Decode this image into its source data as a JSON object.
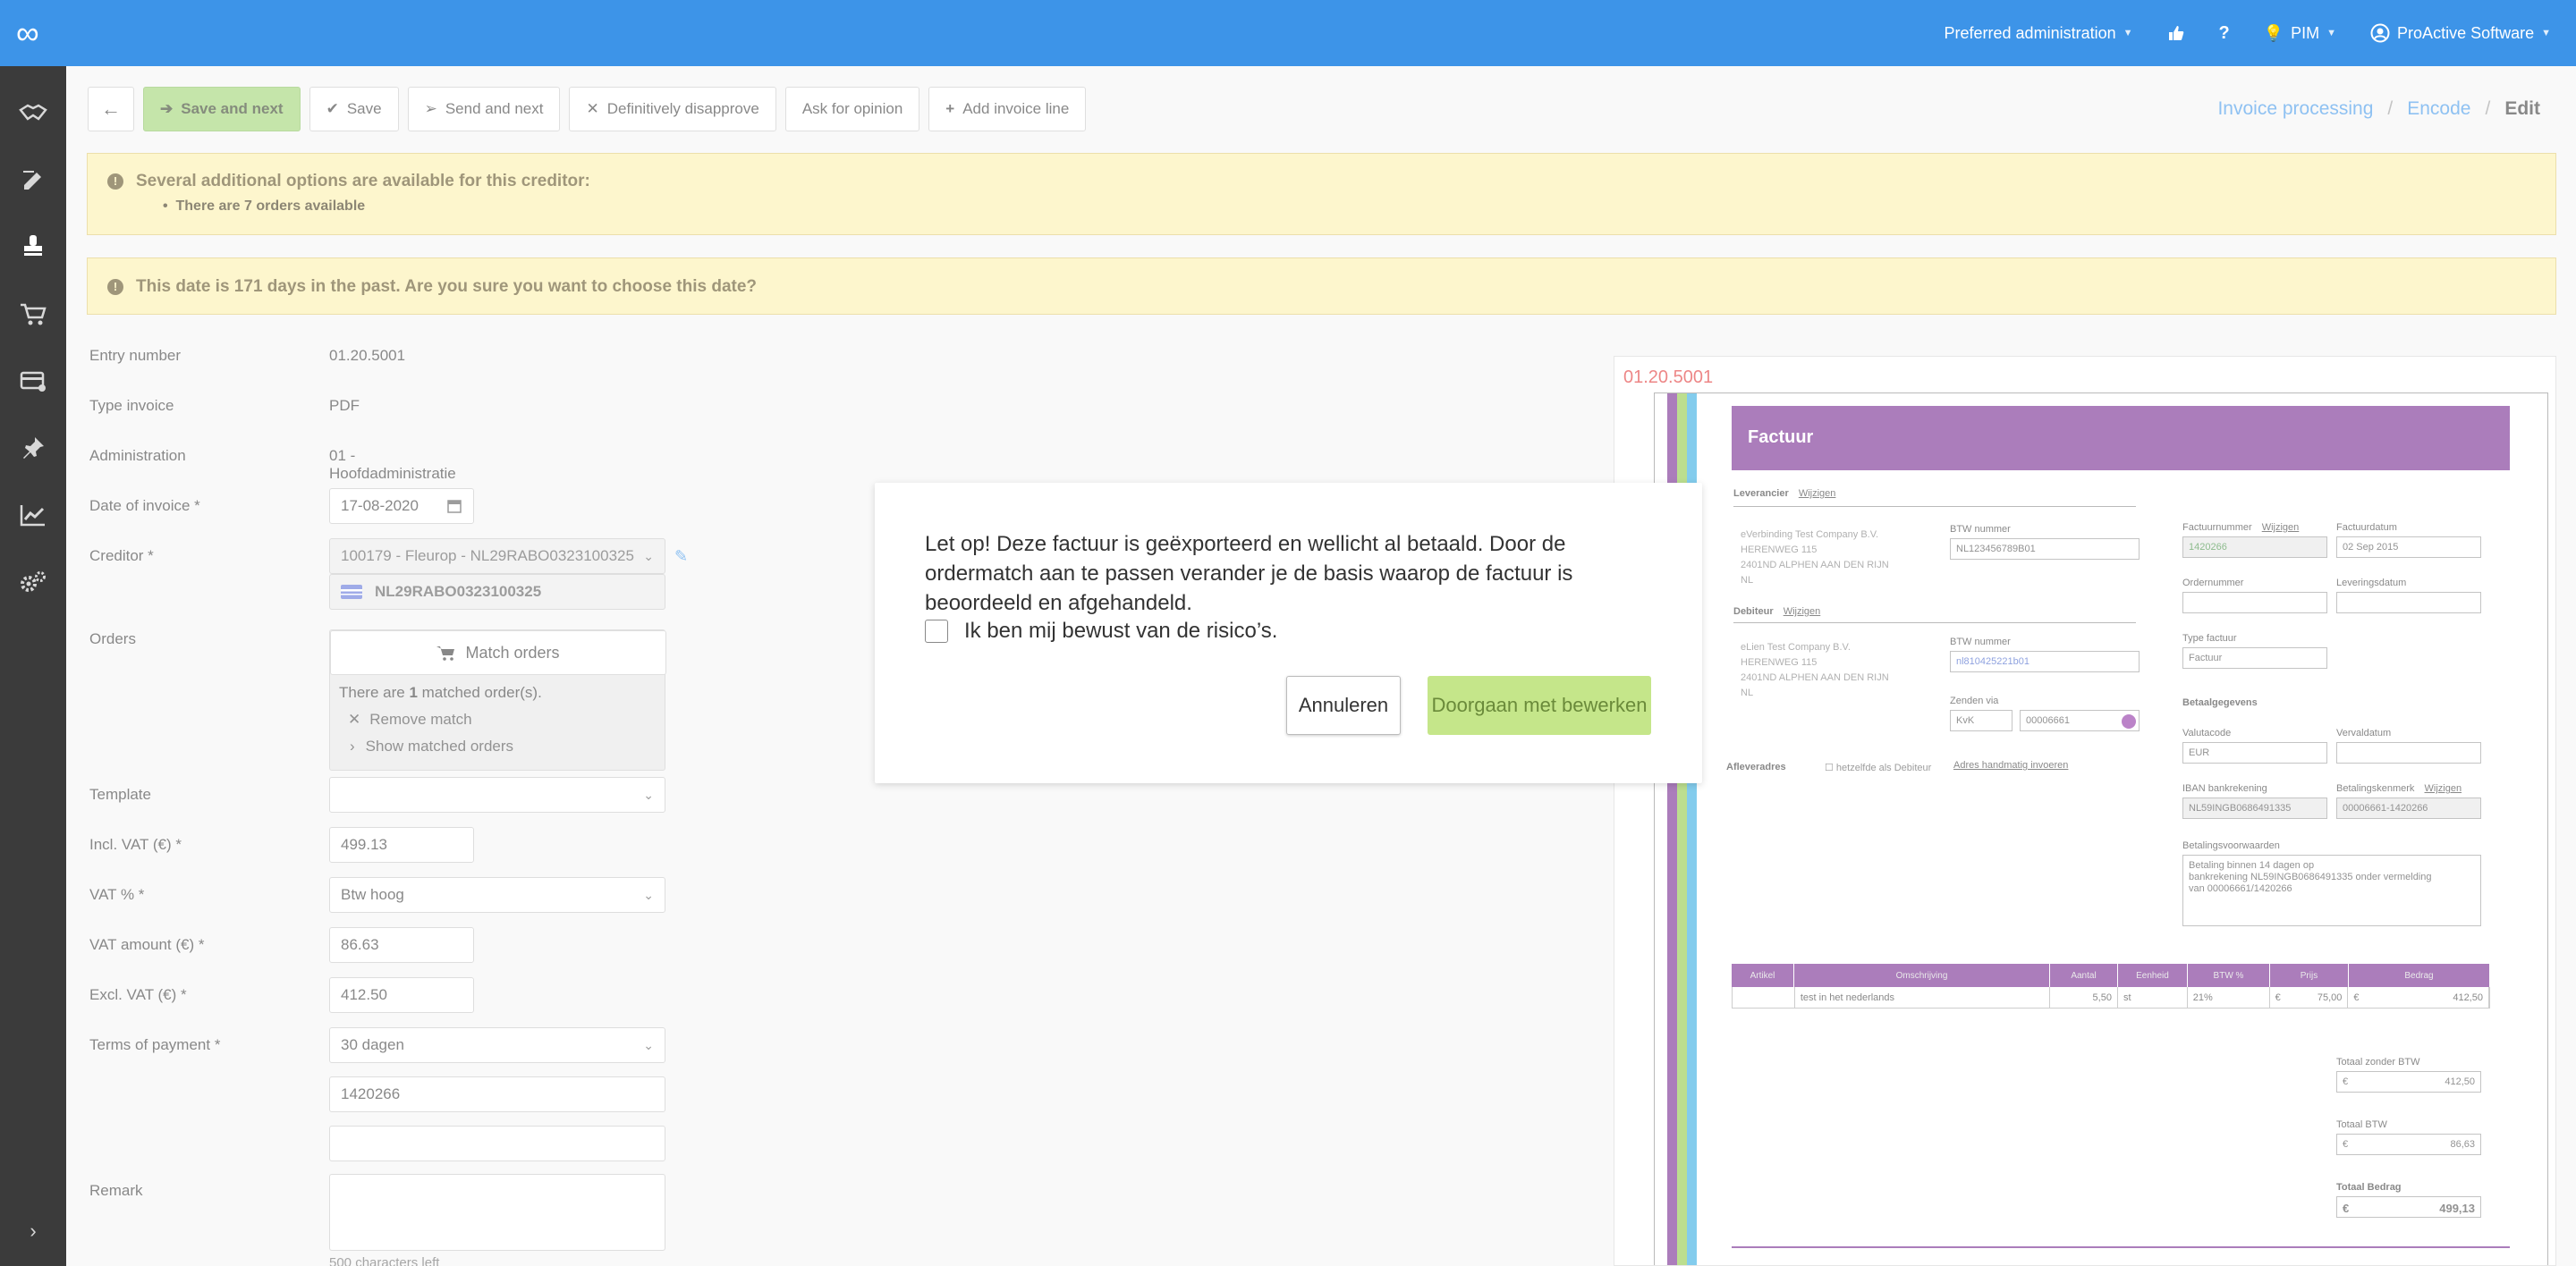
{
  "topbar": {
    "logo": "∞",
    "preferred_admin": "Preferred administration",
    "pim": "PIM",
    "user": "ProActive Software",
    "help": "?"
  },
  "toolbar": {
    "save_next": "Save and next",
    "save": "Save",
    "send_next": "Send and next",
    "disapprove": "Definitively disapprove",
    "ask_opinion": "Ask for opinion",
    "add_line": "Add invoice line"
  },
  "breadcrumb": {
    "l1": "Invoice processing",
    "l2": "Encode",
    "cur": "Edit",
    "sep": "/"
  },
  "alert1": {
    "title": "Several additional options are available for this creditor:",
    "item": "There are 7 orders available"
  },
  "alert2": {
    "text": "This date is 171 days in the past. Are you sure you want to choose this date?"
  },
  "form": {
    "entry_label": "Entry number",
    "entry_value": "01.20.5001",
    "type_label": "Type invoice",
    "type_value": "PDF",
    "admin_label": "Administration",
    "admin_value": "01 - Hoofdadministratie",
    "date_label": "Date of invoice *",
    "date_value": "17-08-2020",
    "creditor_label": "Creditor *",
    "creditor_value": "100179 - Fleurop - NL29RABO0323100325",
    "creditor_iban": "NL29RABO0323100325",
    "orders_label": "Orders",
    "match_orders": "Match orders",
    "matched_pre": "There are ",
    "matched_count": "1",
    "matched_post": " matched order(s).",
    "remove_match": "Remove match",
    "show_matched": "Show matched orders",
    "template_label": "Template",
    "template_value": "",
    "incl_label": "Incl. VAT (€) *",
    "incl_value": "499.13",
    "vatp_label": "VAT % *",
    "vatp_value": "Btw hoog",
    "vata_label": "VAT amount (€) *",
    "vata_value": "86.63",
    "excl_label": "Excl. VAT (€) *",
    "excl_value": "412.50",
    "terms_label": "Terms of payment *",
    "terms_value": "30 dagen",
    "ref_value": "1420266",
    "extra_value": "",
    "remark_label": "Remark",
    "chars_left": "500 characters left"
  },
  "modal": {
    "text": "Let op! Deze factuur is geëxporteerd en wellicht al betaald. Door de ordermatch aan te passen verander je de basis waarop de factuur is beoordeeld en afgehandeld.",
    "checkbox": "Ik ben mij bewust van de risico’s.",
    "cancel": "Annuleren",
    "continue": "Doorgaan met bewerken"
  },
  "preview": {
    "number": "01.20.5001",
    "title": "Factuur",
    "leverancier": "Leverancier",
    "wijzigen": "Wijzigen",
    "sup_name": "eVerbinding Test Company B.V.",
    "sup_street": "HERENWEG 115",
    "sup_city": "2401ND ALPHEN AAN DEN RIJN",
    "sup_country": "NL",
    "btw_label": "BTW nummer",
    "btw1": "NL123456789B01",
    "debiteur": "Debiteur",
    "deb_name": "eLien Test Company B.V.",
    "deb_street": "HERENWEG 115",
    "deb_city": "2401ND ALPHEN AAN DEN RIJN",
    "deb_country": "NL",
    "btw2": "nl810425221b01",
    "zenden_via": "Zenden via",
    "kvk": "KvK",
    "kvk_nr": "00006661",
    "afleveradres": "Afleveradres",
    "zelfde": "hetzelfde als Debiteur",
    "handmatig": "Adres handmatig invoeren",
    "factuurnummer": "Factuurnummer",
    "factuurnummer_value": "1420266",
    "factuurdatum": "Factuurdatum",
    "factuurdatum_value": "02 Sep 2015",
    "ordernummer": "Ordernummer",
    "leveringsdatum": "Leveringsdatum",
    "type_factuur": "Type factuur",
    "type_factuur_value": "Factuur",
    "betaalgegevens": "Betaalgegevens",
    "valutacode": "Valutacode",
    "valutacode_value": "EUR",
    "vervaldatum": "Vervaldatum",
    "iban_label": "IBAN bankrekening",
    "iban_value": "NL59INGB0686491335",
    "kenmerk_label": "Betalingskenmerk",
    "kenmerk_value": "00006661-1420266",
    "voorwaarden_label": "Betalingsvoorwaarden",
    "voorwaarden_l1": "Betaling binnen 14 dagen op",
    "voorwaarden_l2": "bankrekening NL59INGB0686491335 onder vermelding",
    "voorwaarden_l3": "van 00006661/1420266",
    "table_headers": [
      "Artikel",
      "Omschrijving",
      "Aantal",
      "Eenheid",
      "BTW %",
      "Prijs",
      "Bedrag"
    ],
    "table_row": [
      "",
      "test in het nederlands",
      "5,50",
      "st",
      "21%",
      "75,00",
      "412,50"
    ],
    "euro": "€",
    "totaal_zonder": "Totaal zonder BTW",
    "totaal_zonder_value": "412,50",
    "totaal_btw": "Totaal BTW",
    "totaal_btw_value": "86,63",
    "totaal_bedrag": "Totaal Bedrag",
    "totaal_bedrag_value": "499,13"
  },
  "colors": {
    "primary": "#3d94e8",
    "accent_green": "#9bd36d",
    "alert_bg": "#fcf0a9",
    "invoice_purple": "#6e1f8a"
  }
}
